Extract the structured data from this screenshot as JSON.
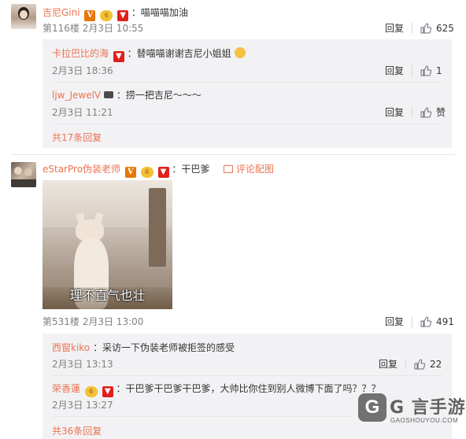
{
  "comments": [
    {
      "user": "吉尼Gini",
      "text": "：喵喵喵加油",
      "floor_time": "第116楼 2月3日 10:55",
      "reply_label": "回复",
      "likes": "625",
      "replies": [
        {
          "user": "卡拉巴比的海",
          "text": "：替喵喵谢谢吉尼小姐姐",
          "time": "2月3日 18:36",
          "reply_label": "回复",
          "likes": "1"
        },
        {
          "user": "ljw_JewelV",
          "text": "：捞一把吉尼～～～",
          "time": "2月3日 11:21",
          "reply_label": "回复",
          "likes": "赞"
        }
      ],
      "more_replies": "共17条回复"
    },
    {
      "user": "eStarPro伪装老师",
      "text": "：干巴爹",
      "pic_link": "评论配图",
      "image_caption": "理不直气也壮",
      "floor_time": "第531楼 2月3日 13:00",
      "reply_label": "回复",
      "likes": "491",
      "replies": [
        {
          "user": "西窗kiko",
          "text": "：采访一下伪装老师被拒签的感受",
          "time": "2月3日 13:13",
          "reply_label": "回复",
          "likes": "22"
        },
        {
          "user": "荣香蓮",
          "text": "：干巴爹干巴爹干巴爹，大帅比你住到别人微博下面了吗？？？",
          "time": "2月3日 13:27",
          "reply_label": "回复",
          "likes": ""
        }
      ],
      "more_replies": "共36条回复"
    }
  ],
  "watermark": {
    "name": "G 言手游",
    "url": "GAOSHOUYOU.COM"
  },
  "colors": {
    "name": "#eb7350",
    "meta": "#808080",
    "subbg": "#f2f2f5"
  }
}
